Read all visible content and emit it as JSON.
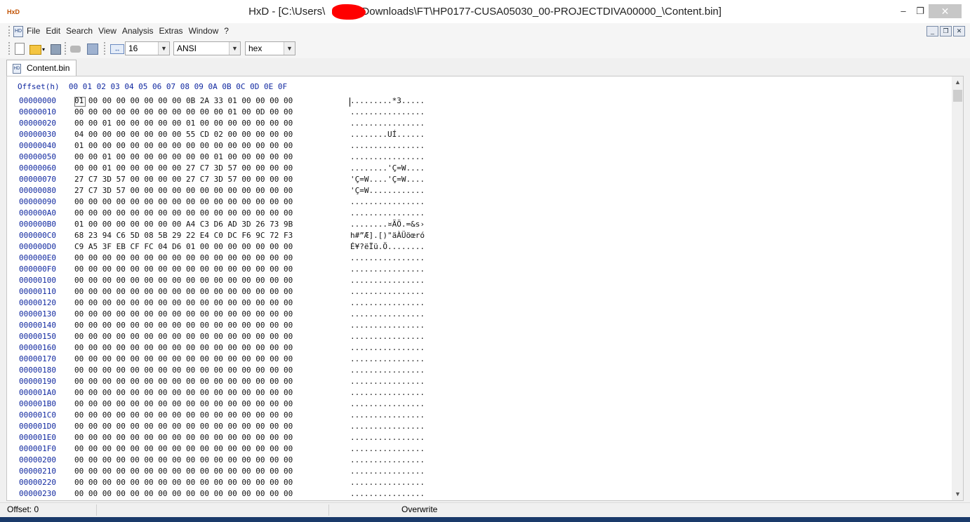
{
  "window": {
    "title_prefix": "HxD - [C:\\Users\\",
    "title_suffix": "\\Downloads\\FT\\HP0177-CUSA05030_00-PROJECTDIVA00000_\\Content.bin]",
    "minimize_glyph": "–",
    "maximize_glyph": "❐",
    "close_glyph": "✕"
  },
  "menu": {
    "items": [
      "File",
      "Edit",
      "Search",
      "View",
      "Analysis",
      "Extras",
      "Window",
      "?"
    ]
  },
  "toolbar": {
    "bytes_per_row": "16",
    "charset": "ANSI",
    "display_mode": "hex"
  },
  "tab": {
    "label": "Content.bin"
  },
  "hex_view": {
    "header": "Offset(h)  00 01 02 03 04 05 06 07 08 09 0A 0B 0C 0D 0E 0F",
    "rows": [
      {
        "offset": "00000000",
        "hex": "01 00 00 00 00 00 00 00 0B 2A 33 01 00 00 00 00",
        "ascii": ".........*3....."
      },
      {
        "offset": "00000010",
        "hex": "00 00 00 00 00 00 00 00 00 00 00 01 00 0D 00 00",
        "ascii": "................"
      },
      {
        "offset": "00000020",
        "hex": "00 00 01 00 00 00 00 00 01 00 00 00 00 00 00 00",
        "ascii": "................"
      },
      {
        "offset": "00000030",
        "hex": "04 00 00 00 00 00 00 00 55 CD 02 00 00 00 00 00",
        "ascii": "........UÍ......"
      },
      {
        "offset": "00000040",
        "hex": "01 00 00 00 00 00 00 00 00 00 00 00 00 00 00 00",
        "ascii": "................"
      },
      {
        "offset": "00000050",
        "hex": "00 00 01 00 00 00 00 00 00 00 01 00 00 00 00 00",
        "ascii": "................"
      },
      {
        "offset": "00000060",
        "hex": "00 00 01 00 00 00 00 00 27 C7 3D 57 00 00 00 00",
        "ascii": "........'Ç=W...."
      },
      {
        "offset": "00000070",
        "hex": "27 C7 3D 57 00 00 00 00 27 C7 3D 57 00 00 00 00",
        "ascii": "'Ç=W....'Ç=W...."
      },
      {
        "offset": "00000080",
        "hex": "27 C7 3D 57 00 00 00 00 00 00 00 00 00 00 00 00",
        "ascii": "'Ç=W............"
      },
      {
        "offset": "00000090",
        "hex": "00 00 00 00 00 00 00 00 00 00 00 00 00 00 00 00",
        "ascii": "................"
      },
      {
        "offset": "000000A0",
        "hex": "00 00 00 00 00 00 00 00 00 00 00 00 00 00 00 00",
        "ascii": "................"
      },
      {
        "offset": "000000B0",
        "hex": "01 00 00 00 00 00 00 00 A4 C3 D6 AD 3D 26 73 9B",
        "ascii": "........¤ÃÖ.=&s›"
      },
      {
        "offset": "000000C0",
        "hex": "68 23 94 C6 5D 08 5B 29 22 E4 C0 DC F6 9C 72 F3",
        "ascii": "h#”Æ].[)\"äÀÜöœró"
      },
      {
        "offset": "000000D0",
        "hex": "C9 A5 3F EB CF FC 04 D6 01 00 00 00 00 00 00 00",
        "ascii": "É¥?ëÏü.Ö........"
      },
      {
        "offset": "000000E0",
        "hex": "00 00 00 00 00 00 00 00 00 00 00 00 00 00 00 00",
        "ascii": "................"
      },
      {
        "offset": "000000F0",
        "hex": "00 00 00 00 00 00 00 00 00 00 00 00 00 00 00 00",
        "ascii": "................"
      },
      {
        "offset": "00000100",
        "hex": "00 00 00 00 00 00 00 00 00 00 00 00 00 00 00 00",
        "ascii": "................"
      },
      {
        "offset": "00000110",
        "hex": "00 00 00 00 00 00 00 00 00 00 00 00 00 00 00 00",
        "ascii": "................"
      },
      {
        "offset": "00000120",
        "hex": "00 00 00 00 00 00 00 00 00 00 00 00 00 00 00 00",
        "ascii": "................"
      },
      {
        "offset": "00000130",
        "hex": "00 00 00 00 00 00 00 00 00 00 00 00 00 00 00 00",
        "ascii": "................"
      },
      {
        "offset": "00000140",
        "hex": "00 00 00 00 00 00 00 00 00 00 00 00 00 00 00 00",
        "ascii": "................"
      },
      {
        "offset": "00000150",
        "hex": "00 00 00 00 00 00 00 00 00 00 00 00 00 00 00 00",
        "ascii": "................"
      },
      {
        "offset": "00000160",
        "hex": "00 00 00 00 00 00 00 00 00 00 00 00 00 00 00 00",
        "ascii": "................"
      },
      {
        "offset": "00000170",
        "hex": "00 00 00 00 00 00 00 00 00 00 00 00 00 00 00 00",
        "ascii": "................"
      },
      {
        "offset": "00000180",
        "hex": "00 00 00 00 00 00 00 00 00 00 00 00 00 00 00 00",
        "ascii": "................"
      },
      {
        "offset": "00000190",
        "hex": "00 00 00 00 00 00 00 00 00 00 00 00 00 00 00 00",
        "ascii": "................"
      },
      {
        "offset": "000001A0",
        "hex": "00 00 00 00 00 00 00 00 00 00 00 00 00 00 00 00",
        "ascii": "................"
      },
      {
        "offset": "000001B0",
        "hex": "00 00 00 00 00 00 00 00 00 00 00 00 00 00 00 00",
        "ascii": "................"
      },
      {
        "offset": "000001C0",
        "hex": "00 00 00 00 00 00 00 00 00 00 00 00 00 00 00 00",
        "ascii": "................"
      },
      {
        "offset": "000001D0",
        "hex": "00 00 00 00 00 00 00 00 00 00 00 00 00 00 00 00",
        "ascii": "................"
      },
      {
        "offset": "000001E0",
        "hex": "00 00 00 00 00 00 00 00 00 00 00 00 00 00 00 00",
        "ascii": "................"
      },
      {
        "offset": "000001F0",
        "hex": "00 00 00 00 00 00 00 00 00 00 00 00 00 00 00 00",
        "ascii": "................"
      },
      {
        "offset": "00000200",
        "hex": "00 00 00 00 00 00 00 00 00 00 00 00 00 00 00 00",
        "ascii": "................"
      },
      {
        "offset": "00000210",
        "hex": "00 00 00 00 00 00 00 00 00 00 00 00 00 00 00 00",
        "ascii": "................"
      },
      {
        "offset": "00000220",
        "hex": "00 00 00 00 00 00 00 00 00 00 00 00 00 00 00 00",
        "ascii": "................"
      },
      {
        "offset": "00000230",
        "hex": "00 00 00 00 00 00 00 00 00 00 00 00 00 00 00 00",
        "ascii": "................"
      }
    ]
  },
  "status": {
    "offset": "Offset: 0",
    "mode": "Overwrite"
  },
  "colors": {
    "offset_text": "#1028a0",
    "redaction": "#ff0000"
  }
}
